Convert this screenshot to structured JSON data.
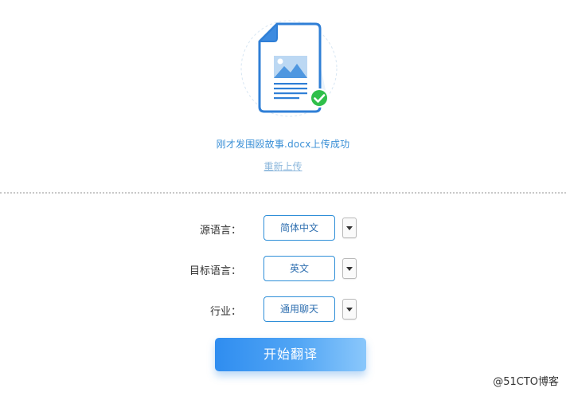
{
  "upload": {
    "status_text": "刚才发围殴故事.docx上传成功",
    "reupload_label": "重新上传"
  },
  "form": {
    "source_language": {
      "label": "源语言：",
      "value": "简体中文"
    },
    "target_language": {
      "label": "目标语言：",
      "value": "英文"
    },
    "industry": {
      "label": "行业：",
      "value": "通用聊天"
    }
  },
  "actions": {
    "start_label": "开始翻译"
  },
  "watermark": "@51CTO博客",
  "icons": {
    "document": "document-icon",
    "image": "image-icon",
    "success": "check-circle-icon",
    "dropdown": "chevron-down-icon"
  },
  "colors": {
    "accent": "#2f8fd8",
    "status_text": "#3a8fd6",
    "success": "#2fbf4a",
    "button_gradient_start": "#2f8df0",
    "button_gradient_end": "#8ac7fb"
  }
}
